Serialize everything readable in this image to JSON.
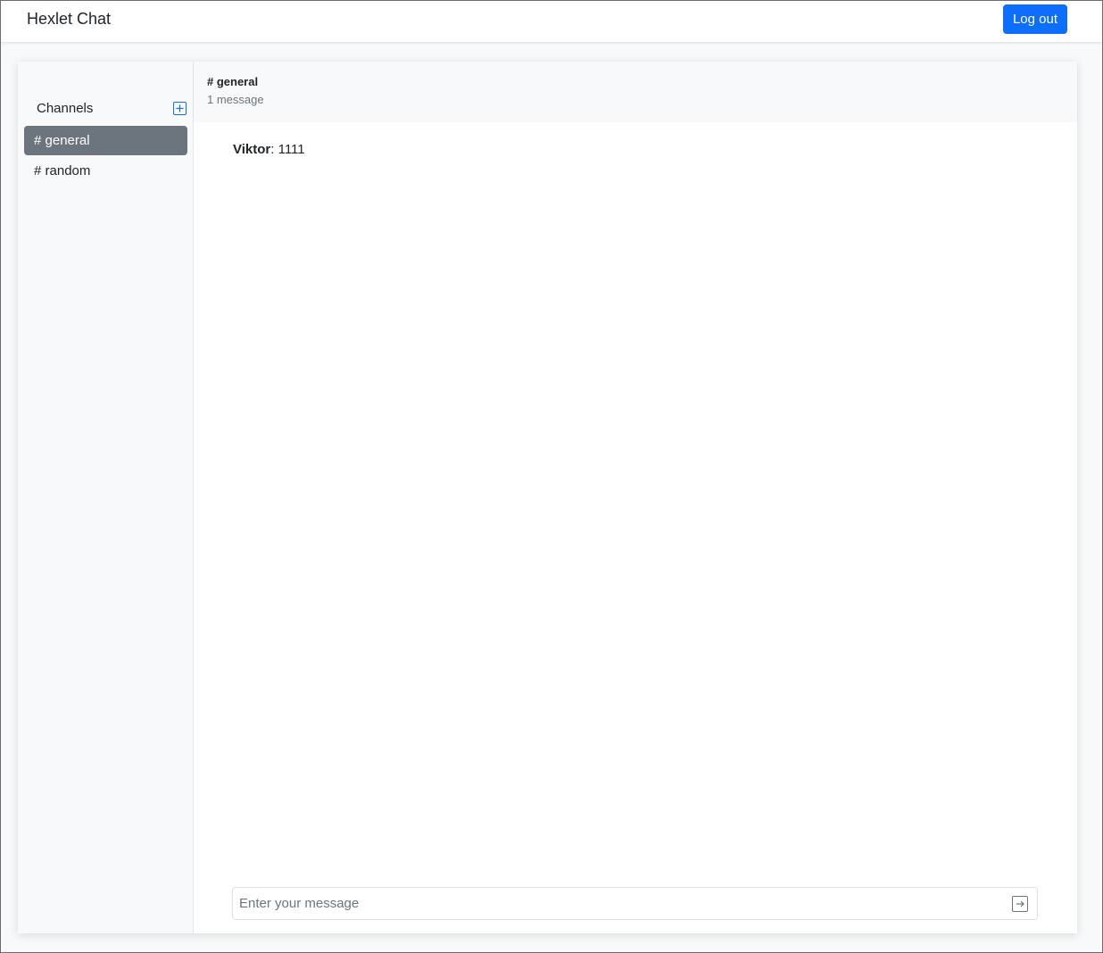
{
  "navbar": {
    "brand": "Hexlet Chat",
    "logout_label": "Log out"
  },
  "sidebar": {
    "title": "Channels",
    "add_icon": "plus-square-icon",
    "channels": [
      {
        "label": "# general",
        "active": true
      },
      {
        "label": "# random",
        "active": false
      }
    ]
  },
  "chat": {
    "channel_name": "# general",
    "message_count": "1 message",
    "messages": [
      {
        "author": "Viktor",
        "separator": ": ",
        "text": "1111"
      }
    ],
    "input": {
      "placeholder": "Enter your message",
      "value": ""
    },
    "send_icon": "arrow-right-square-icon"
  },
  "colors": {
    "primary": "#0d6efd",
    "active_channel": "#6c757d",
    "page_bg": "#f8f9fa"
  }
}
